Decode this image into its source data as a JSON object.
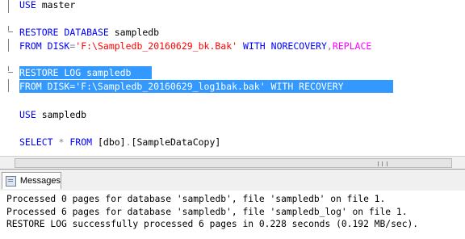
{
  "editor": {
    "lines": [
      {
        "id": "use-master",
        "tokens": [
          {
            "t": "USE",
            "c": "kw"
          },
          {
            "t": " master",
            "c": "txt"
          }
        ]
      },
      {
        "id": "restore-db",
        "tokens": [
          {
            "t": "RESTORE",
            "c": "kw"
          },
          {
            "t": " ",
            "c": "txt"
          },
          {
            "t": "DATABASE",
            "c": "kw"
          },
          {
            "t": " sampledb",
            "c": "txt"
          }
        ]
      },
      {
        "id": "from-disk-bak",
        "tokens": [
          {
            "t": "FROM",
            "c": "kw"
          },
          {
            "t": " ",
            "c": "txt"
          },
          {
            "t": "DISK",
            "c": "kw"
          },
          {
            "t": "=",
            "c": "pun"
          },
          {
            "t": "'F:\\Sampledb_20160629_bk.Bak'",
            "c": "str"
          },
          {
            "t": " ",
            "c": "txt"
          },
          {
            "t": "WITH",
            "c": "kw"
          },
          {
            "t": " ",
            "c": "txt"
          },
          {
            "t": "NORECOVERY",
            "c": "kw"
          },
          {
            "t": ",",
            "c": "pun"
          },
          {
            "t": "REPLACE",
            "c": "fn"
          }
        ]
      },
      {
        "id": "restore-log",
        "tokens": [
          {
            "t": "RESTORE LOG sampledb ",
            "c": "txt"
          }
        ]
      },
      {
        "id": "from-disk-log",
        "tokens": [
          {
            "t": "FROM DISK='F:\\Sampledb_20160629_log1bak.bak' WITH RECOVERY",
            "c": "txt"
          }
        ]
      },
      {
        "id": "use-sampledb",
        "tokens": [
          {
            "t": "USE",
            "c": "kw"
          },
          {
            "t": " sampledb",
            "c": "txt"
          }
        ]
      },
      {
        "id": "select",
        "tokens": [
          {
            "t": "SELECT",
            "c": "kw"
          },
          {
            "t": " ",
            "c": "txt"
          },
          {
            "t": "*",
            "c": "pun"
          },
          {
            "t": " ",
            "c": "txt"
          },
          {
            "t": "FROM",
            "c": "kw"
          },
          {
            "t": " [dbo]",
            "c": "txt"
          },
          {
            "t": ".",
            "c": "pun"
          },
          {
            "t": "[SampleDataCopy]",
            "c": "txt"
          }
        ]
      }
    ]
  },
  "results_tab": {
    "label": "Messages",
    "icon": "messages-icon"
  },
  "messages": [
    "Processed 0 pages for database 'sampledb', file 'sampledb' on file 1.",
    "Processed 6 pages for database 'sampledb', file 'sampledb_log' on file 1.",
    "RESTORE LOG successfully processed 6 pages in 0.228 seconds (0.192 MB/sec)."
  ],
  "colors": {
    "keyword": "#0000ff",
    "string": "#ff0000",
    "function": "#ff00ff",
    "selection": "#3399ff"
  }
}
